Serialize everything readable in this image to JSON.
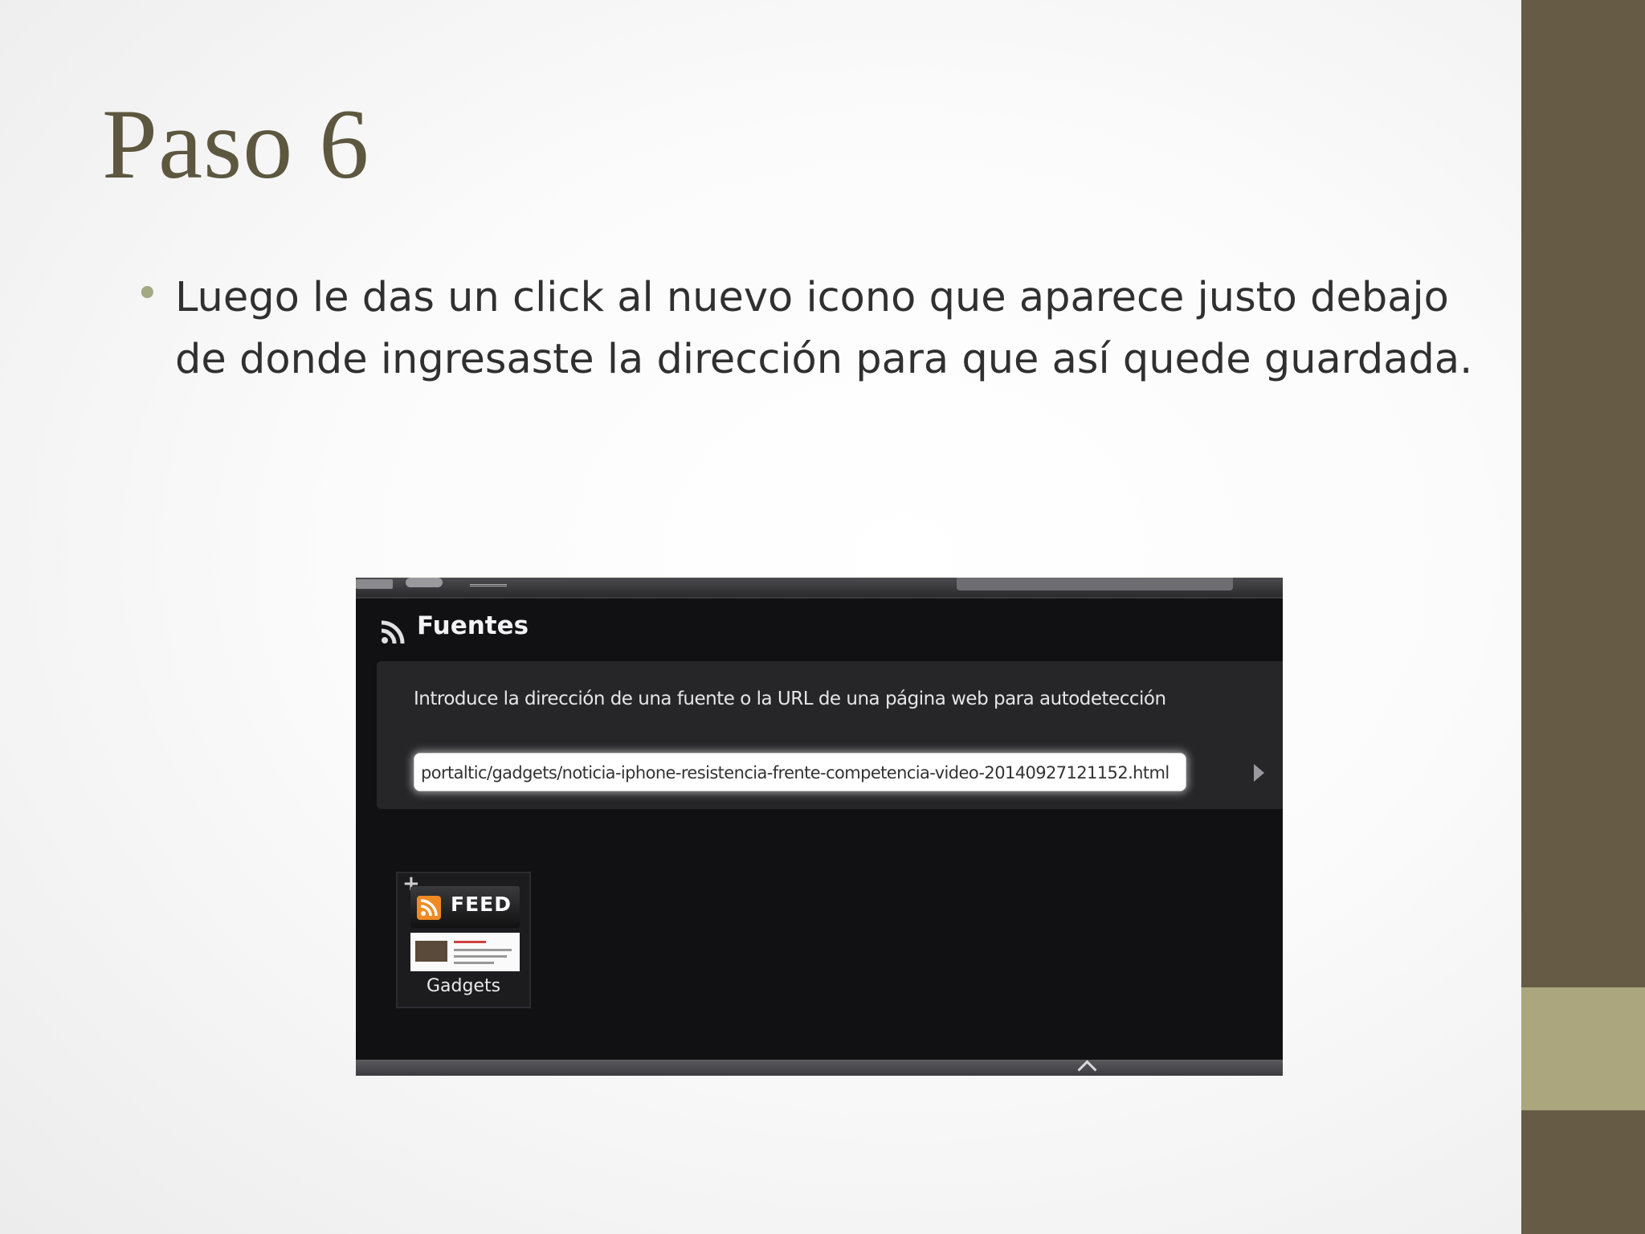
{
  "slide": {
    "title": "Paso 6",
    "bullet_glyph": "•",
    "bullet_text": "Luego le das un click al nuevo icono que aparece justo debajo de donde ingresaste la dirección para que así quede guardada."
  },
  "theme": {
    "side_band_color": "#665c45",
    "side_accent_color": "#aca67e",
    "title_color": "#5d573f",
    "bullet_color": "#a3a983"
  },
  "screenshot": {
    "section_icon": "rss-icon",
    "section_title": "Fuentes",
    "prompt": "Introduce la dirección de una fuente o la URL de una página web para autodetección",
    "url_value": "portaltic/gadgets/noticia-iphone-resistencia-frente-competencia-video-20140927121152.html",
    "submit_icon": "play-arrow-icon",
    "feed_tile": {
      "add_glyph": "+",
      "badge_text": "FEED",
      "name": "Gadgets"
    },
    "collapse_icon": "chevron-up-icon"
  }
}
